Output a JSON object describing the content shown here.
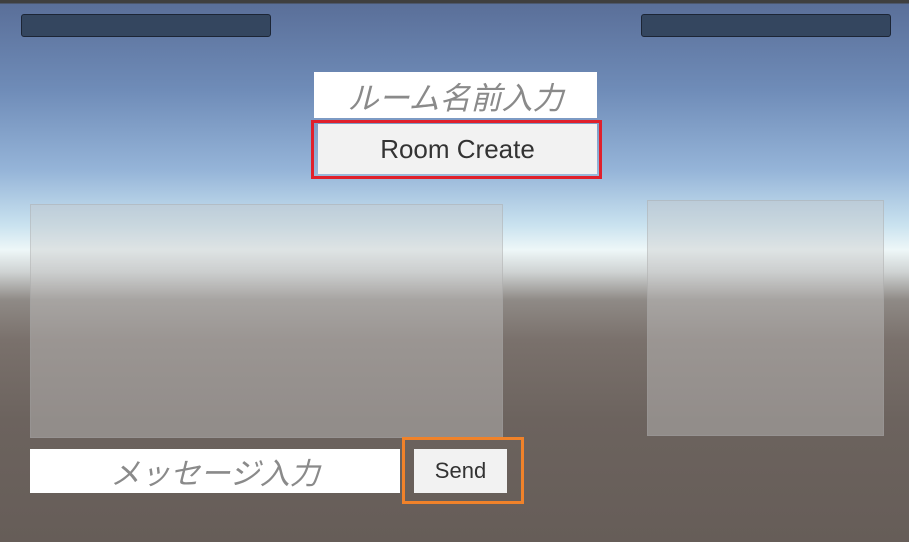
{
  "room_name_input": {
    "placeholder": "ルーム名前入力"
  },
  "room_create_button": {
    "label": "Room Create"
  },
  "message_input": {
    "placeholder": "メッセージ入力"
  },
  "send_button": {
    "label": "Send"
  },
  "colors": {
    "top_bar": "#34465f",
    "room_create_highlight": "#e0202c",
    "send_highlight": "#f0822a",
    "button_face": "#f2f2f2",
    "placeholder_text": "#8a8a8a"
  }
}
